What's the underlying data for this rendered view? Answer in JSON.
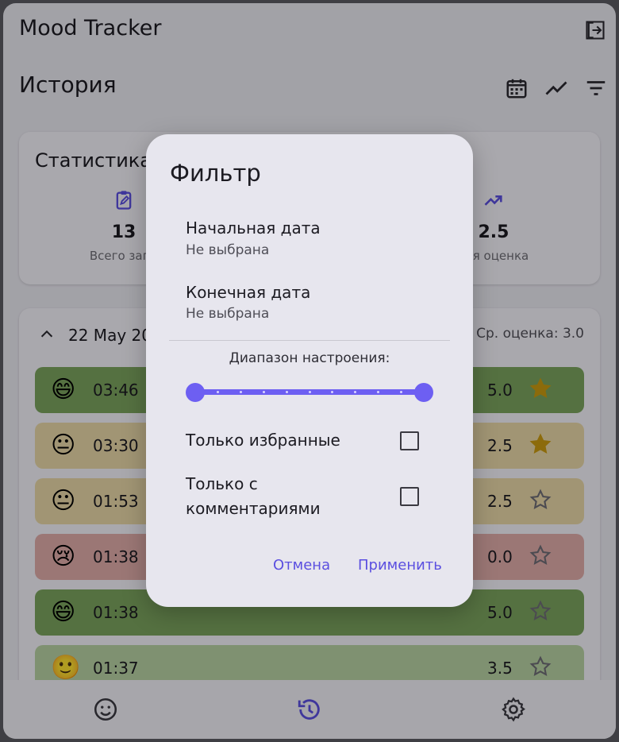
{
  "app": {
    "title": "Mood Tracker"
  },
  "page": {
    "title": "История"
  },
  "stats": {
    "title": "Статистика",
    "items": [
      {
        "value": "13",
        "label": "Всего запи",
        "icon": "clipboard-edit-icon"
      },
      {
        "value": "2.5",
        "label": "тая оценка",
        "icon": "trending-up-icon"
      }
    ]
  },
  "day": {
    "date": "22 May 20",
    "avg": "• Ср. оценка: 3.0"
  },
  "entries": [
    {
      "emoji": "😄",
      "time": "03:46",
      "score": "5.0",
      "favorite": true,
      "color": "#7aa35d"
    },
    {
      "emoji": "😐",
      "time": "03:30",
      "score": "2.5",
      "favorite": true,
      "color": "#e7d6a6"
    },
    {
      "emoji": "😐",
      "time": "01:53",
      "score": "2.5",
      "favorite": false,
      "color": "#e7d6a6"
    },
    {
      "emoji": "😢",
      "time": "01:38",
      "score": "0.0",
      "favorite": false,
      "color": "#deaba8"
    },
    {
      "emoji": "😄",
      "time": "01:38",
      "score": "5.0",
      "favorite": false,
      "color": "#7aa35d"
    },
    {
      "emoji": "🙂",
      "time": "01:37",
      "score": "3.5",
      "favorite": false,
      "color": "#b7d0a2"
    }
  ],
  "dialog": {
    "title": "Фильтр",
    "start_date": {
      "title": "Начальная дата",
      "value": "Не выбрана"
    },
    "end_date": {
      "title": "Конечная дата",
      "value": "Не выбрана"
    },
    "range_label": "Диапазон настроения:",
    "mood_range": {
      "min": 0,
      "max": 5,
      "low": 0,
      "high": 5
    },
    "only_favorites": {
      "label": "Только избранные",
      "checked": false
    },
    "only_comments": {
      "label_line1": "Только с",
      "label_line2": "комментариями",
      "checked": false
    },
    "cancel": "Отмена",
    "apply": "Применить"
  },
  "nav": {
    "items": [
      "mood-icon",
      "history-icon",
      "settings-icon"
    ],
    "active": "history-icon"
  },
  "colors": {
    "accent": "#6d5ff2",
    "star_on": "#c99a10",
    "star_off": "#6d6c75"
  }
}
